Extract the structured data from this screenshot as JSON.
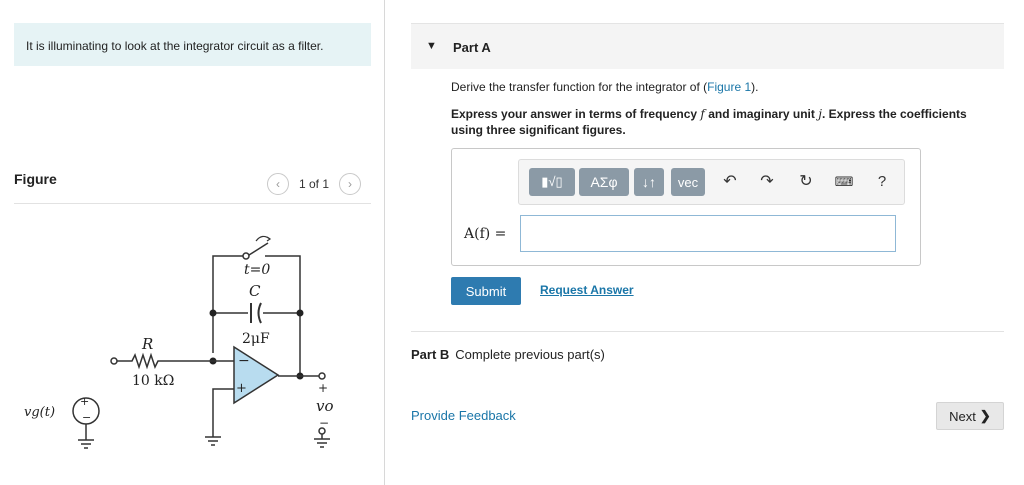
{
  "intro_text": "It is illuminating to look at the integrator circuit as a filter.",
  "figure": {
    "label": "Figure",
    "count": "1 of 1",
    "prev_icon": "chevron-left-icon",
    "next_icon": "chevron-right-icon",
    "circuit": {
      "switch_label": "t=0",
      "cap_symbol": "C",
      "cap_value": "2μF",
      "res_symbol": "R",
      "res_value": "10 kΩ",
      "opamp_plus": "+",
      "opamp_minus": "−",
      "source_label": "vg(t)",
      "out_plus": "+",
      "out_label": "vo",
      "out_minus": "−"
    }
  },
  "part_a": {
    "title": "Part A",
    "question_prefix": "Derive the transfer function for the integrator of (",
    "question_link": "Figure 1",
    "question_suffix": ").",
    "instr_1": "Express your answer in terms of frequency ",
    "instr_f": "f",
    "instr_2": " and imaginary unit ",
    "instr_j": "j",
    "instr_3": ". Express the coefficients using three significant figures.",
    "toolbar": {
      "templates": "▮√▯",
      "greek": "ΑΣφ",
      "arrows": "↓↑",
      "vec": "vec",
      "undo_icon": "undo-icon",
      "redo_icon": "redo-icon",
      "reset_icon": "reset-icon",
      "keyboard_icon": "keyboard-icon",
      "help": "?"
    },
    "answer_label": "A(f) =",
    "answer_value": "",
    "submit": "Submit",
    "request": "Request Answer"
  },
  "part_b": {
    "title": "Part B",
    "text": "Complete previous part(s)"
  },
  "feedback": "Provide Feedback",
  "next": "Next",
  "colors": {
    "accent": "#2e7bb0",
    "link": "#1a76a8",
    "intro_bg": "#e6f3f5",
    "toolbar_btn": "#8b9aa6",
    "opamp_fill": "#b8dcef"
  }
}
